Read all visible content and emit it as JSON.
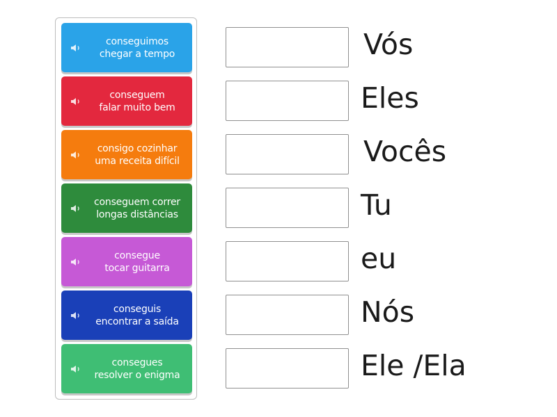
{
  "cards": [
    {
      "line1": "conseguimos",
      "line2": "chegar a tempo",
      "color": "#2aa3e8",
      "icon": "speaker-icon"
    },
    {
      "line1": "conseguem",
      "line2": "falar muito bem",
      "color": "#e3283e",
      "icon": "speaker-icon"
    },
    {
      "line1": "consigo cozinhar",
      "line2": "uma receita difícil",
      "color": "#f57c0e",
      "icon": "speaker-icon"
    },
    {
      "line1": "conseguem correr",
      "line2": "longas distâncias",
      "color": "#2e8b3c",
      "icon": "speaker-icon"
    },
    {
      "line1": "consegue",
      "line2": "tocar guitarra",
      "color": "#c659d6",
      "icon": "speaker-icon"
    },
    {
      "line1": "conseguis",
      "line2": "encontrar a saída",
      "color": "#1a40b8",
      "icon": "speaker-icon"
    },
    {
      "line1": "consegues",
      "line2": "resolver o enigma",
      "color": "#3fbe74",
      "icon": "speaker-icon"
    }
  ],
  "targets": [
    {
      "label": "Vós"
    },
    {
      "label": "Eles"
    },
    {
      "label": "Vocês"
    },
    {
      "label": "Tu"
    },
    {
      "label": "eu"
    },
    {
      "label": "Nós"
    },
    {
      "label": "Ele /Ela"
    }
  ]
}
